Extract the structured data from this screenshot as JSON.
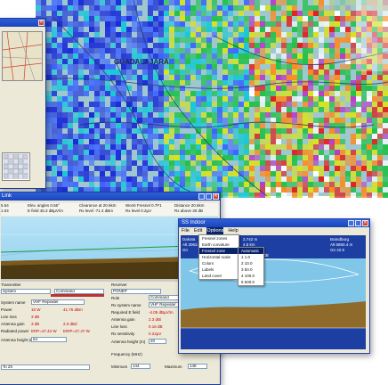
{
  "map": {
    "city_label": "GUADALAJARA",
    "colors": [
      "#1a2bd8",
      "#3b63ff",
      "#19c7d6",
      "#22c04a",
      "#d8e21f",
      "#ff8a1c",
      "#e02020",
      "#b73cc9",
      "#ffffff"
    ]
  },
  "topleft_window": {
    "title": "",
    "close_glyph": "✕"
  },
  "link_window": {
    "title": "Link",
    "readout_row1": [
      "5.64",
      "Elev. angles 0.56°",
      "Clearance at 20.6km",
      "Worst Fresnel 0.7F1",
      "Distance 20.6km"
    ],
    "readout_row2": [
      "1.04",
      "E field 45.3 dBµV/m",
      "Rx level -71.4 dBm",
      "Rx level 0.2µV",
      "Rx above 30 dB"
    ],
    "left_panel": {
      "section_label": "Transmitter",
      "system_combo": "System",
      "com_label": "Command",
      "rows": [
        {
          "label": "System name",
          "value": "VHF Repeater"
        },
        {
          "label": "Power",
          "value": "15 W"
        },
        {
          "label": "Line loss",
          "value": "3 dB"
        },
        {
          "label": "Antenna gain",
          "value": "3 dB"
        },
        {
          "label": "Radiated power",
          "value": "ERP=47.42 W"
        },
        {
          "label": "Antenna height (m)",
          "value": "64"
        }
      ],
      "extra_values": [
        "41.76 dBm",
        "2.0 dBd",
        "EIRP=47.47 W"
      ],
      "bottom_combo": "To Zn"
    },
    "right_panel": {
      "section_label": "Receiver",
      "system_combo": "PONEP",
      "com_label": "Command",
      "rows": [
        {
          "label": "Role",
          "value": "Command"
        },
        {
          "label": "Rx system name",
          "value": "VHF Repeater"
        },
        {
          "label": "Required E field",
          "value": "-4.05 dBµV/m"
        },
        {
          "label": "Antenna gain",
          "value": "2.3 dBi"
        },
        {
          "label": "Line loss",
          "value": "0.16 dB"
        },
        {
          "label": "Rx sensitivity",
          "value": "0.22µV"
        },
        {
          "label": "Antenna height (m)",
          "value": "20"
        }
      ],
      "freq_label": "Frequency (MHz)",
      "min_label": "Minimum",
      "min_value": "144",
      "max_label": "Maximum",
      "max_value": "148"
    }
  },
  "sub_window": {
    "title": "SS Indoor",
    "menu": [
      "File",
      "Edit",
      "Options",
      "Help"
    ],
    "readout": [
      {
        "a": "Dakota",
        "b": "2,742 m",
        "c": "Brandburg"
      },
      {
        "a": "Alt 3063.4 m",
        "b": "4.5 km",
        "c": "Alt 6850.4 m"
      },
      {
        "a": "Gn",
        "b": "4,834 dBm",
        "c": "Gn 42.5"
      },
      {
        "a": "",
        "b": "space 51.1 dB",
        "c": ""
      }
    ],
    "dropdown": [
      {
        "label": "Fresnel zones",
        "hl": false
      },
      {
        "label": "Earth curvature",
        "hl": false
      },
      {
        "label": "Fresnel zone",
        "hl": true
      },
      {
        "label": "Horizontal scale",
        "hl": false
      },
      {
        "label": "Colors",
        "hl": false
      },
      {
        "label": "Labels",
        "hl": false
      },
      {
        "label": "Land cover",
        "hl": false
      }
    ],
    "submenu": [
      {
        "label": "Automatic",
        "hl": true
      },
      {
        "label": "1  1.0",
        "hl": false
      },
      {
        "label": "2  10.0",
        "hl": false
      },
      {
        "label": "3  50.0",
        "hl": false
      },
      {
        "label": "4  100.0",
        "hl": false
      },
      {
        "label": "5  500.0",
        "hl": false
      }
    ]
  }
}
